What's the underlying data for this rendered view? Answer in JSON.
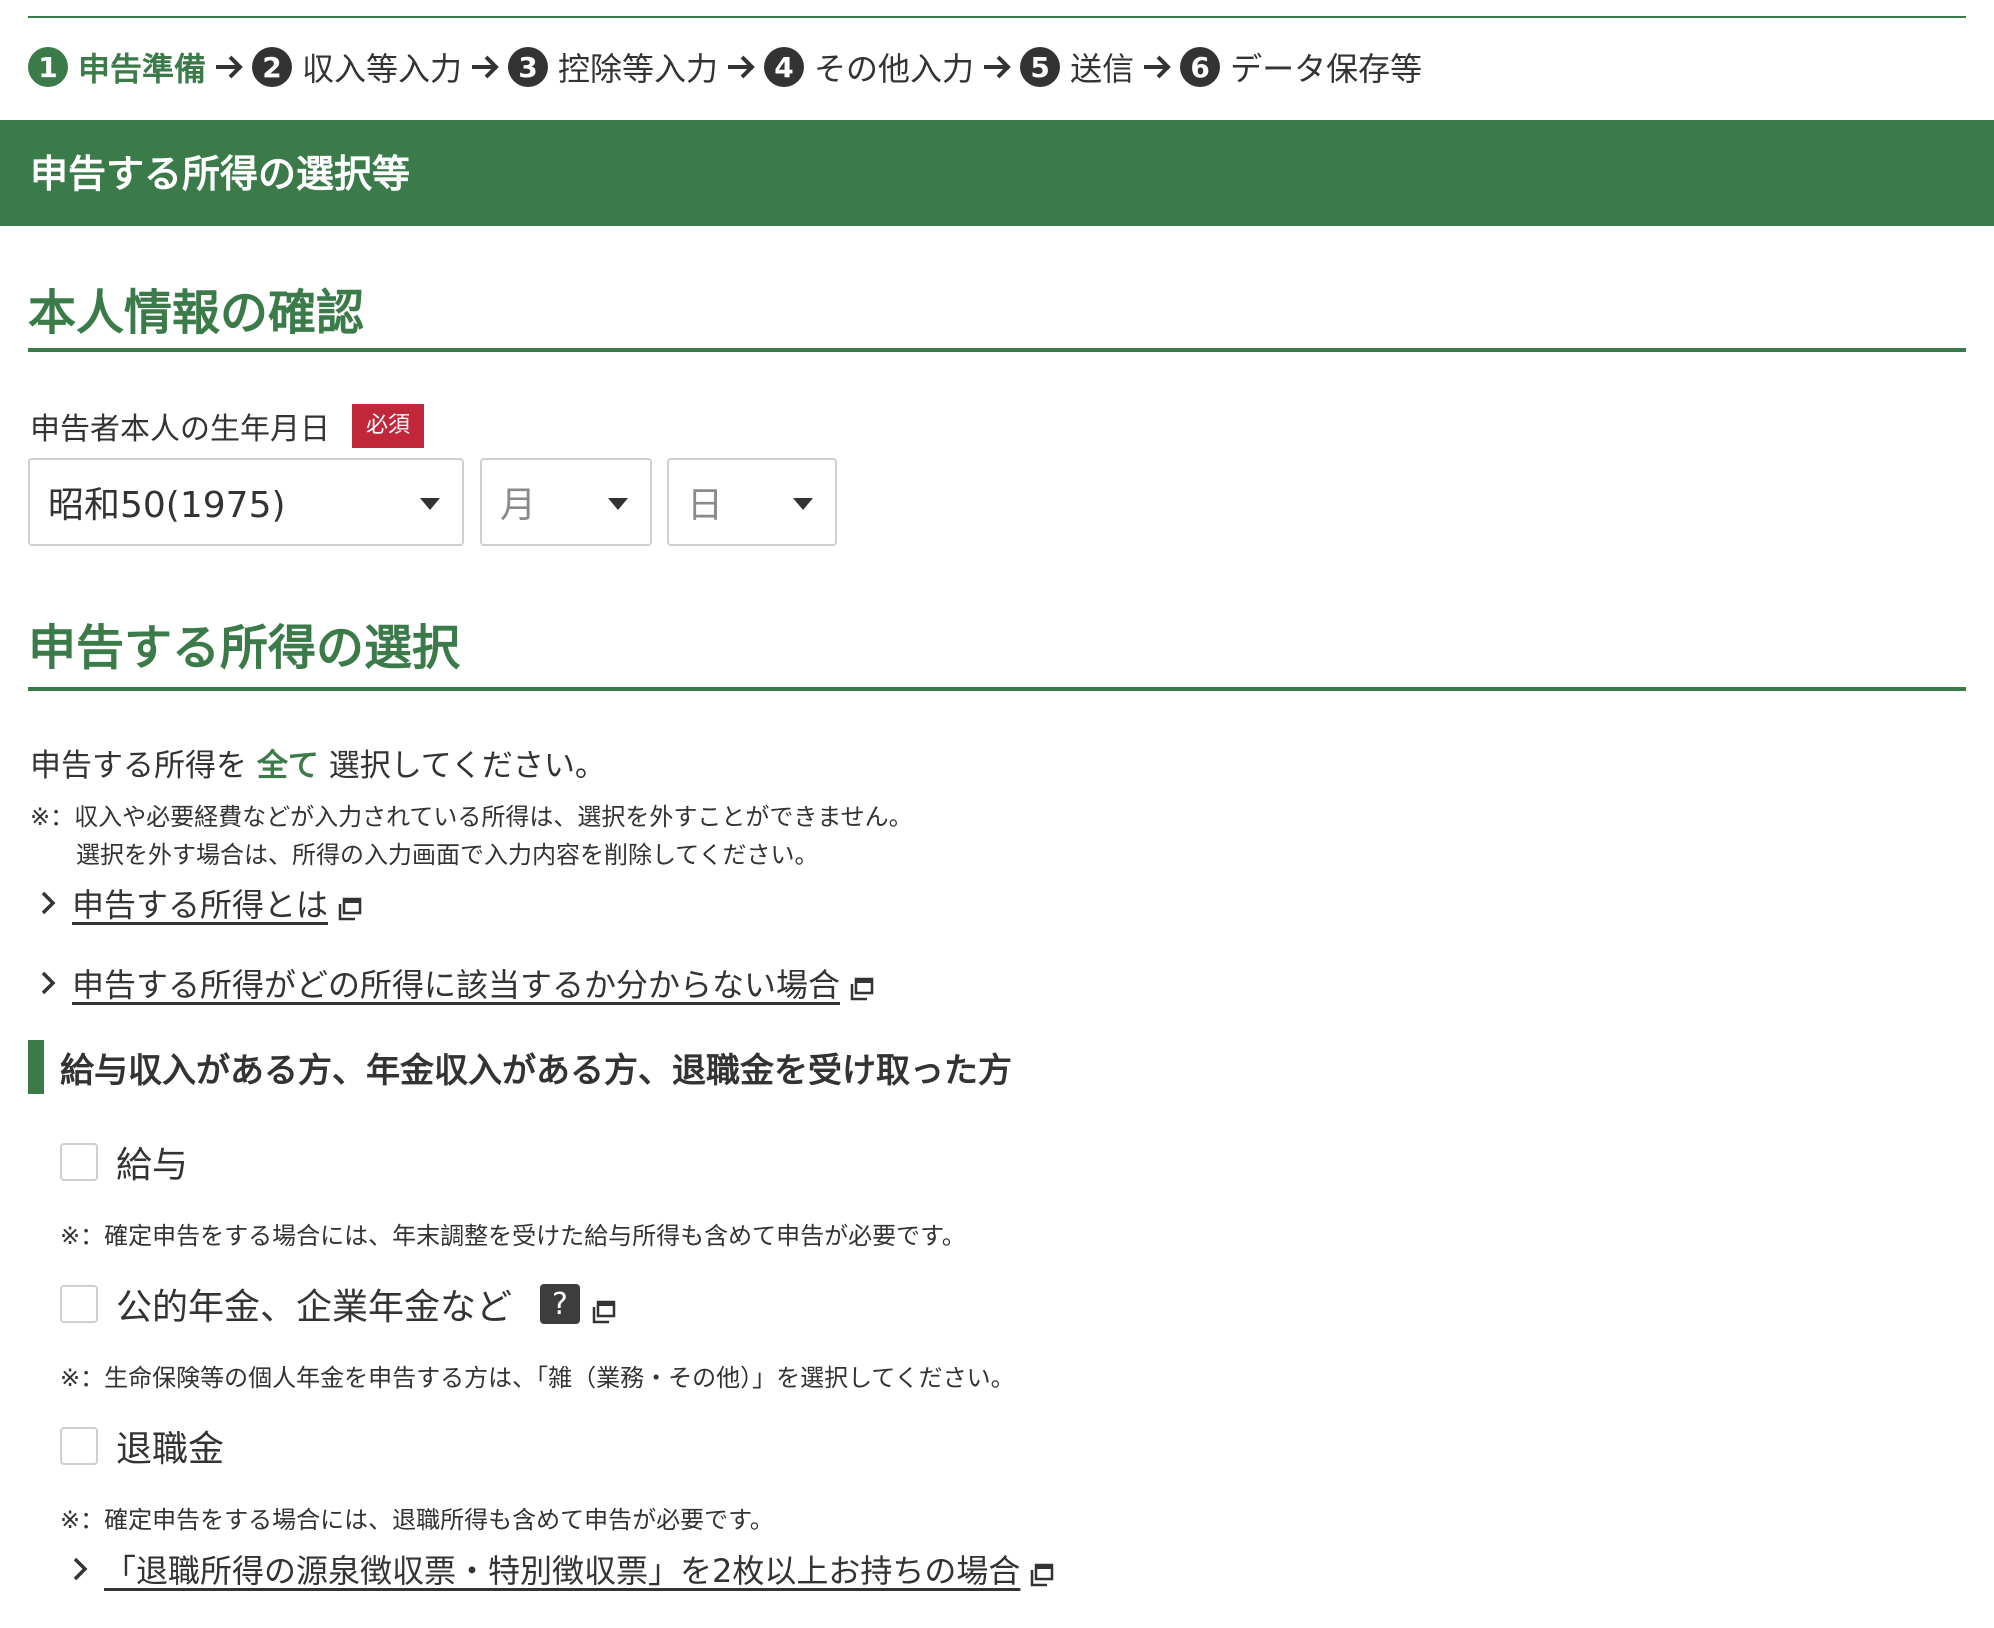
{
  "steps": [
    {
      "num": "1",
      "label": "申告準備",
      "current": true
    },
    {
      "num": "2",
      "label": "収入等入力"
    },
    {
      "num": "3",
      "label": "控除等入力"
    },
    {
      "num": "4",
      "label": "その他入力"
    },
    {
      "num": "5",
      "label": "送信"
    },
    {
      "num": "6",
      "label": "データ保存等"
    }
  ],
  "header": {
    "title": "申告する所得の選択等"
  },
  "identity": {
    "title": "本人情報の確認",
    "birth_label": "申告者本人の生年月日",
    "required_badge": "必須",
    "era_value": "昭和50(1975)",
    "month_placeholder": "月",
    "day_placeholder": "日"
  },
  "income": {
    "title": "申告する所得の選択",
    "instruction_before": "申告する所得を",
    "instruction_emphasis": "全て",
    "instruction_after": "選択してください。",
    "note_line1": "※：収入や必要経費などが入力されている所得は、選択を外すことができません。",
    "note_line2": "選択を外す場合は、所得の入力画面で入力内容を削除してください。",
    "link1": "申告する所得とは",
    "link2": "申告する所得がどの所得に該当するか分からない場合",
    "group_heading": "給与収入がある方、年金収入がある方、退職金を受け取った方",
    "salary_label": "給与",
    "salary_note": "※：確定申告をする場合には、年末調整を受けた給与所得も含めて申告が必要です。",
    "pension_label": "公的年金、企業年金など",
    "pension_help": "?",
    "pension_note": "※：生命保険等の個人年金を申告する方は、「雑（業務・その他）」を選択してください。",
    "retirement_label": "退職金",
    "retirement_note": "※：確定申告をする場合には、退職所得も含めて申告が必要です。",
    "retirement_link": "「退職所得の源泉徴収票・特別徴収票」を2枚以上お持ちの場合"
  },
  "colors": {
    "accent": "#3b7a49",
    "required": "#c0273a"
  }
}
